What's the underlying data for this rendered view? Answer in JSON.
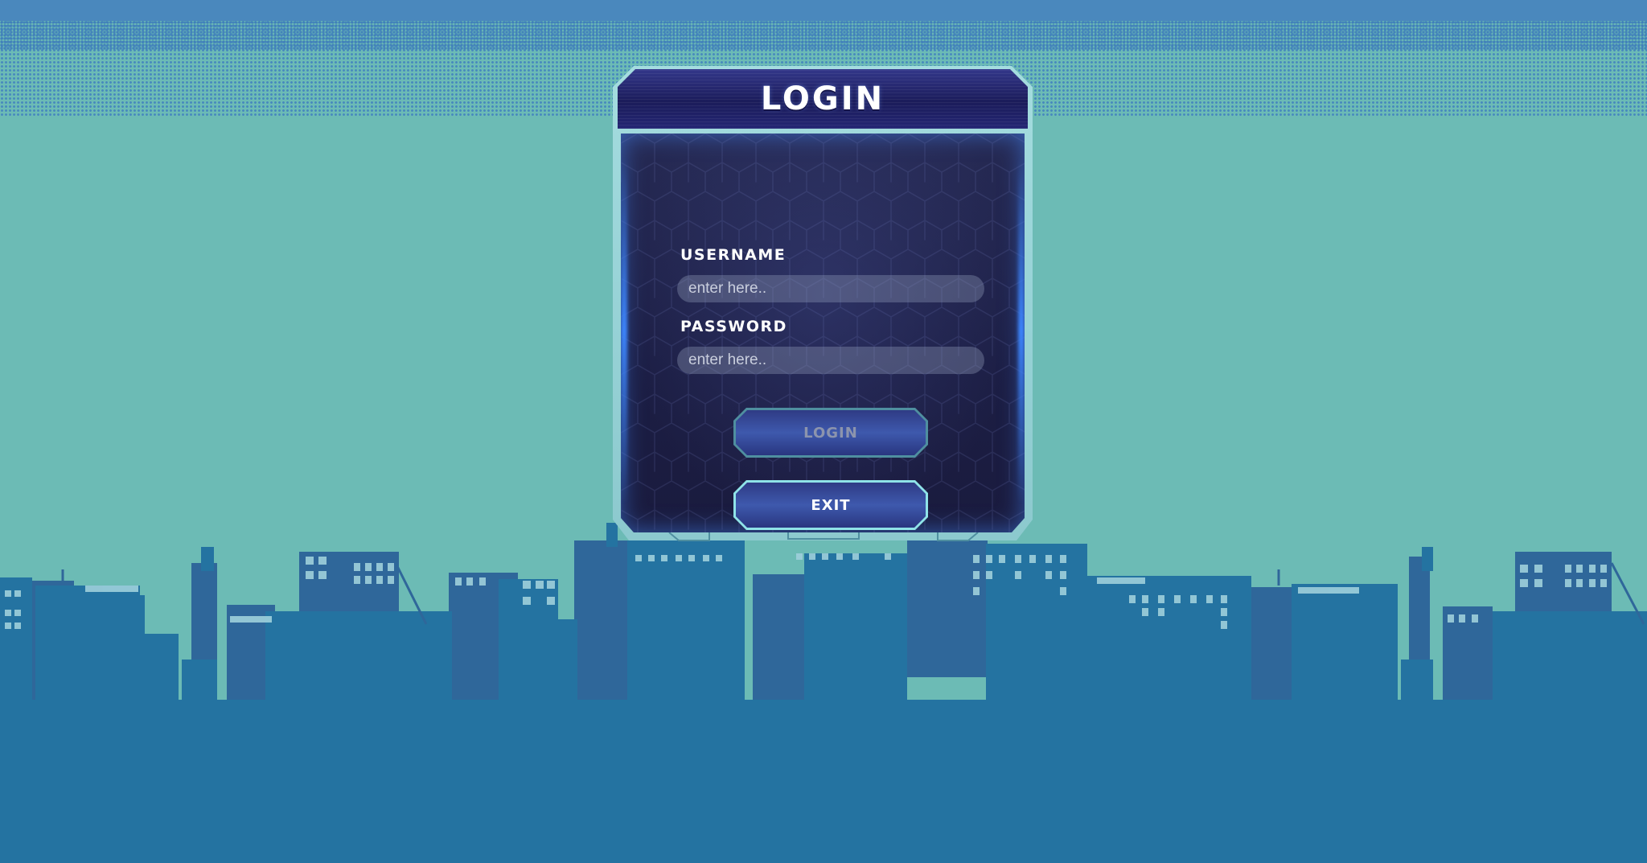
{
  "dialog": {
    "title": "LOGIN",
    "username": {
      "label": "USERNAME",
      "placeholder": "enter here..",
      "value": ""
    },
    "password": {
      "label": "PASSWORD",
      "placeholder": "enter here..",
      "value": ""
    },
    "login_button": "LOGIN",
    "exit_button": "EXIT"
  },
  "colors": {
    "sky": "#6cbbb5",
    "top_band": "#4a88bd",
    "city_front": "#2473a1",
    "city_back": "#2f679a",
    "panel_header": "#1b1c5a",
    "panel_body": "#1c1e44",
    "button_fill": "#3e59ad",
    "exit_border": "#8fe3e8"
  }
}
